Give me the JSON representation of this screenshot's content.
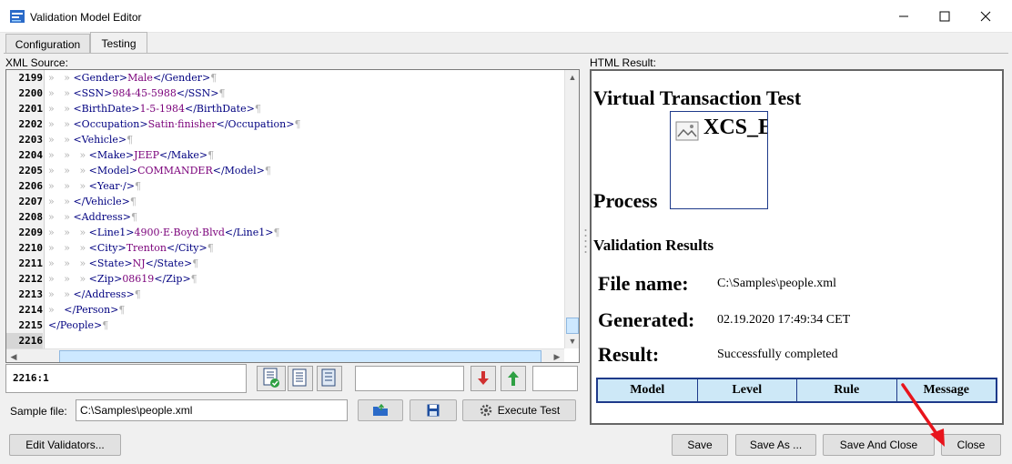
{
  "window": {
    "title": "Validation Model Editor"
  },
  "tabs": [
    {
      "label": "Configuration"
    },
    {
      "label": "Testing"
    }
  ],
  "xml_panel": {
    "label": "XML Source:"
  },
  "html_panel": {
    "label": "HTML Result:"
  },
  "xml_lines": [
    {
      "no": "2199",
      "indent": "»   » ",
      "segs": [
        {
          "t": "<Gender>",
          "c": "tag"
        },
        {
          "t": "Male",
          "c": "val"
        },
        {
          "t": "</Gender>",
          "c": "tag"
        }
      ]
    },
    {
      "no": "2200",
      "indent": "»   » ",
      "segs": [
        {
          "t": "<SSN>",
          "c": "tag"
        },
        {
          "t": "984-45-5988",
          "c": "val"
        },
        {
          "t": "</SSN>",
          "c": "tag"
        }
      ]
    },
    {
      "no": "2201",
      "indent": "»   » ",
      "segs": [
        {
          "t": "<BirthDate>",
          "c": "tag"
        },
        {
          "t": "1-5-1984",
          "c": "val"
        },
        {
          "t": "</BirthDate>",
          "c": "tag"
        }
      ]
    },
    {
      "no": "2202",
      "indent": "»   » ",
      "segs": [
        {
          "t": "<Occupation>",
          "c": "tag"
        },
        {
          "t": "Satin·finisher",
          "c": "val"
        },
        {
          "t": "</Occupation>",
          "c": "tag"
        }
      ]
    },
    {
      "no": "2203",
      "indent": "»   » ",
      "segs": [
        {
          "t": "<Vehicle>",
          "c": "tag"
        }
      ]
    },
    {
      "no": "2204",
      "indent": "»   »   » ",
      "segs": [
        {
          "t": "<Make>",
          "c": "tag"
        },
        {
          "t": "JEEP",
          "c": "val"
        },
        {
          "t": "</Make>",
          "c": "tag"
        }
      ]
    },
    {
      "no": "2205",
      "indent": "»   »   » ",
      "segs": [
        {
          "t": "<Model>",
          "c": "tag"
        },
        {
          "t": "COMMANDER",
          "c": "val"
        },
        {
          "t": "</Model>",
          "c": "tag"
        }
      ]
    },
    {
      "no": "2206",
      "indent": "»   »   » ",
      "segs": [
        {
          "t": "<Year·/>",
          "c": "tag"
        }
      ]
    },
    {
      "no": "2207",
      "indent": "»   » ",
      "segs": [
        {
          "t": "</Vehicle>",
          "c": "tag"
        }
      ]
    },
    {
      "no": "2208",
      "indent": "»   » ",
      "segs": [
        {
          "t": "<Address>",
          "c": "tag"
        }
      ]
    },
    {
      "no": "2209",
      "indent": "»   »   » ",
      "segs": [
        {
          "t": "<Line1>",
          "c": "tag"
        },
        {
          "t": "4900·E·Boyd·Blvd",
          "c": "val"
        },
        {
          "t": "</Line1>",
          "c": "tag"
        }
      ]
    },
    {
      "no": "2210",
      "indent": "»   »   » ",
      "segs": [
        {
          "t": "<City>",
          "c": "tag"
        },
        {
          "t": "Trenton",
          "c": "val"
        },
        {
          "t": "</City>",
          "c": "tag"
        }
      ]
    },
    {
      "no": "2211",
      "indent": "»   »   » ",
      "segs": [
        {
          "t": "<State>",
          "c": "tag"
        },
        {
          "t": "NJ",
          "c": "val"
        },
        {
          "t": "</State>",
          "c": "tag"
        }
      ]
    },
    {
      "no": "2212",
      "indent": "»   »   » ",
      "segs": [
        {
          "t": "<Zip>",
          "c": "tag"
        },
        {
          "t": "08619",
          "c": "val"
        },
        {
          "t": "</Zip>",
          "c": "tag"
        }
      ]
    },
    {
      "no": "2213",
      "indent": "»   » ",
      "segs": [
        {
          "t": "</Address>",
          "c": "tag"
        }
      ]
    },
    {
      "no": "2214",
      "indent": "»   ",
      "segs": [
        {
          "t": "</Person>",
          "c": "tag"
        }
      ]
    },
    {
      "no": "2215",
      "indent": "",
      "segs": [
        {
          "t": "</People>",
          "c": "tag"
        }
      ]
    },
    {
      "no": "2216",
      "indent": "",
      "segs": [],
      "current": true
    }
  ],
  "status": {
    "cursor_position": "2216:1"
  },
  "sample_file": {
    "label": "Sample file:",
    "value": "C:\\Samples\\people.xml"
  },
  "buttons": {
    "execute_test": "Execute Test",
    "edit_validators": "Edit Validators...",
    "save": "Save",
    "save_as": "Save As ...",
    "save_and_close": "Save And Close",
    "close": "Close"
  },
  "result": {
    "heading": "Virtual Transaction Test",
    "logo_alt": "XCS_E",
    "process": "Process",
    "validation_results": "Validation Results",
    "file_name_label": "File name:",
    "file_name_value": "C:\\Samples\\people.xml",
    "generated_label": "Generated:",
    "generated_value": "02.19.2020 17:49:34 CET",
    "result_label": "Result:",
    "result_value": "Successfully completed",
    "table_headers": [
      "Model",
      "Level",
      "Rule",
      "Message"
    ]
  },
  "colors": {
    "tag": "#000080",
    "value": "#7a007a",
    "table_header_bg": "#cde8f7",
    "annotation_arrow": "#e8141c"
  }
}
